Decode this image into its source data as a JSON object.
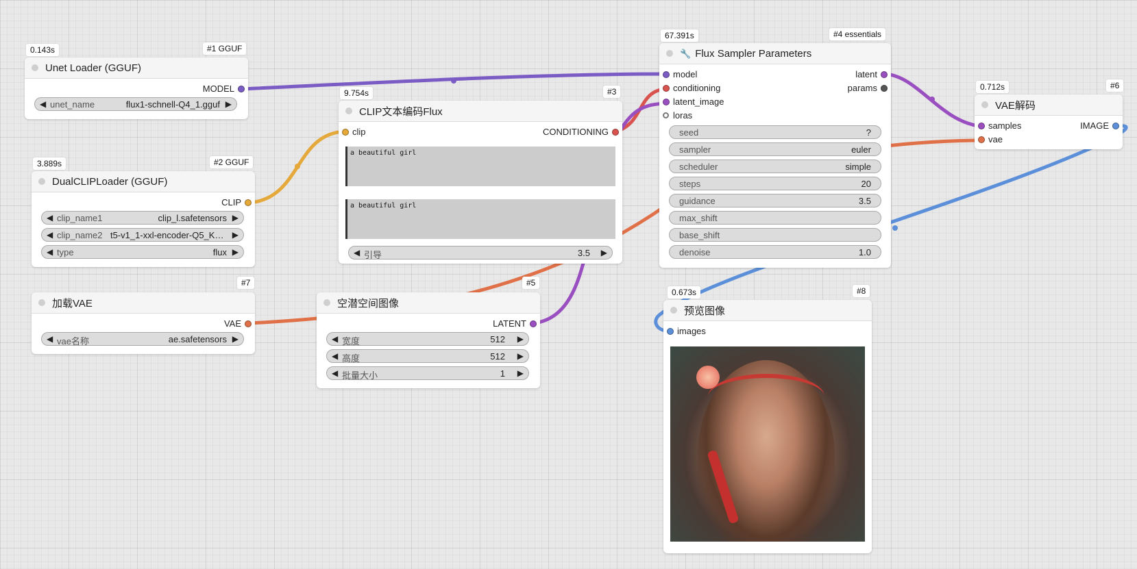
{
  "colors": {
    "model": "#7b5cc4",
    "clip": "#e5a83a",
    "conditioning": "#d9534f",
    "latent": "#9a4fc0",
    "vae": "#e07047",
    "image": "#5b8fd9",
    "params": "#555555"
  },
  "icons": {
    "sampler": "wrench-icon"
  },
  "nodes": {
    "unet": {
      "time": "0.143s",
      "id": "#1 GGUF",
      "title": "Unet Loader (GGUF)",
      "out": "MODEL",
      "widget": {
        "label": "unet_name",
        "value": "flux1-schnell-Q4_1.gguf"
      }
    },
    "dualclip": {
      "time": "3.889s",
      "id": "#2 GGUF",
      "title": "DualCLIPLoader (GGUF)",
      "out": "CLIP",
      "widgets": [
        {
          "label": "clip_name1",
          "value": "clip_l.safetensors"
        },
        {
          "label": "clip_name2",
          "value": "t5-v1_1-xxl-encoder-Q5_K_..."
        },
        {
          "label": "type",
          "value": "flux"
        }
      ]
    },
    "vaeloader": {
      "id": "#7",
      "title": "加载VAE",
      "out": "VAE",
      "widget": {
        "label": "vae名称",
        "value": "ae.safetensors"
      }
    },
    "clipenc": {
      "time": "9.754s",
      "id": "#3",
      "title": "CLIP文本编码Flux",
      "in": "clip",
      "out": "CONDITIONING",
      "text1": "a beautiful girl",
      "text2": "a beautiful girl",
      "widget": {
        "label": "引导",
        "value": "3.5"
      }
    },
    "latent": {
      "id": "#5",
      "title": "空潜空间图像",
      "out": "LATENT",
      "widgets": [
        {
          "label": "宽度",
          "value": "512"
        },
        {
          "label": "高度",
          "value": "512"
        },
        {
          "label": "批量大小",
          "value": "1"
        }
      ]
    },
    "sampler": {
      "time": "67.391s",
      "id": "#4 essentials",
      "title": "Flux Sampler Parameters",
      "inputs": [
        "model",
        "conditioning",
        "latent_image",
        "loras"
      ],
      "outputs": [
        "latent",
        "params"
      ],
      "widgets": [
        {
          "label": "seed",
          "value": "?"
        },
        {
          "label": "sampler",
          "value": "euler"
        },
        {
          "label": "scheduler",
          "value": "simple"
        },
        {
          "label": "steps",
          "value": "20"
        },
        {
          "label": "guidance",
          "value": "3.5"
        },
        {
          "label": "max_shift",
          "value": ""
        },
        {
          "label": "base_shift",
          "value": ""
        },
        {
          "label": "denoise",
          "value": "1.0"
        }
      ]
    },
    "vaedecode": {
      "time": "0.712s",
      "id": "#6",
      "title": "VAE解码",
      "inputs": [
        "samples",
        "vae"
      ],
      "out": "IMAGE"
    },
    "preview": {
      "time": "0.673s",
      "id": "#8",
      "title": "预览图像",
      "in": "images"
    }
  }
}
